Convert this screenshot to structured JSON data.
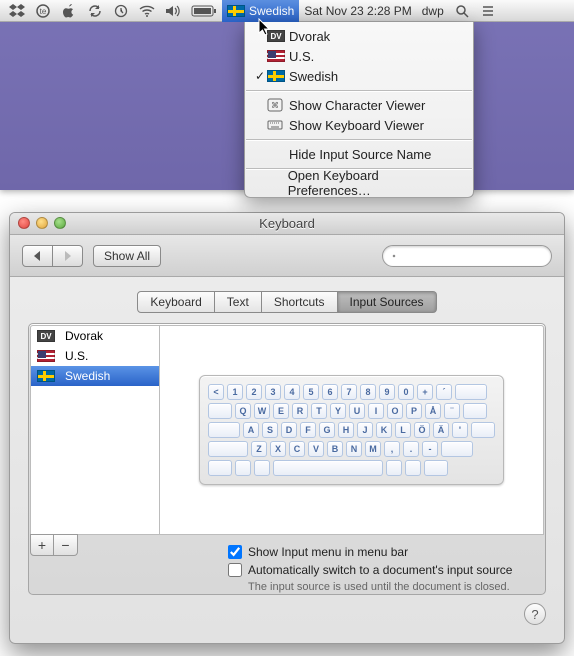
{
  "menubar": {
    "selected_label": "Swedish",
    "datetime": "Sat Nov 23  2:28 PM",
    "user": "dwp"
  },
  "dropdown": {
    "items": [
      {
        "icon": "dv",
        "label": "Dvorak",
        "checked": false
      },
      {
        "icon": "us",
        "label": "U.S.",
        "checked": false
      },
      {
        "icon": "se",
        "label": "Swedish",
        "checked": true
      }
    ],
    "show_char": "Show Character Viewer",
    "show_kbd": "Show Keyboard Viewer",
    "hide_name": "Hide Input Source Name",
    "open_prefs": "Open Keyboard Preferences…"
  },
  "window": {
    "title": "Keyboard",
    "show_all": "Show All",
    "search_placeholder": "",
    "tabs": [
      "Keyboard",
      "Text",
      "Shortcuts",
      "Input Sources"
    ],
    "active_tab": "Input Sources",
    "sources": [
      {
        "icon": "dv",
        "label": "Dvorak",
        "selected": false
      },
      {
        "icon": "us",
        "label": "U.S.",
        "selected": false
      },
      {
        "icon": "se",
        "label": "Swedish",
        "selected": true
      }
    ],
    "keyboard_rows": [
      [
        "<",
        "1",
        "2",
        "3",
        "4",
        "5",
        "6",
        "7",
        "8",
        "9",
        "0",
        "+",
        "´"
      ],
      [
        "Q",
        "W",
        "E",
        "R",
        "T",
        "Y",
        "U",
        "I",
        "O",
        "P",
        "Å",
        "¨"
      ],
      [
        "A",
        "S",
        "D",
        "F",
        "G",
        "H",
        "J",
        "K",
        "L",
        "Ö",
        "Ä",
        "'"
      ],
      [
        "Z",
        "X",
        "C",
        "V",
        "B",
        "N",
        "M",
        ",",
        ".",
        "-"
      ]
    ],
    "opt_show_menu": "Show Input menu in menu bar",
    "opt_show_menu_checked": true,
    "opt_auto_switch": "Automatically switch to a document's input source",
    "opt_auto_switch_checked": false,
    "hint": "The input source is used until the document is closed.",
    "add": "+",
    "remove": "−",
    "help": "?"
  }
}
